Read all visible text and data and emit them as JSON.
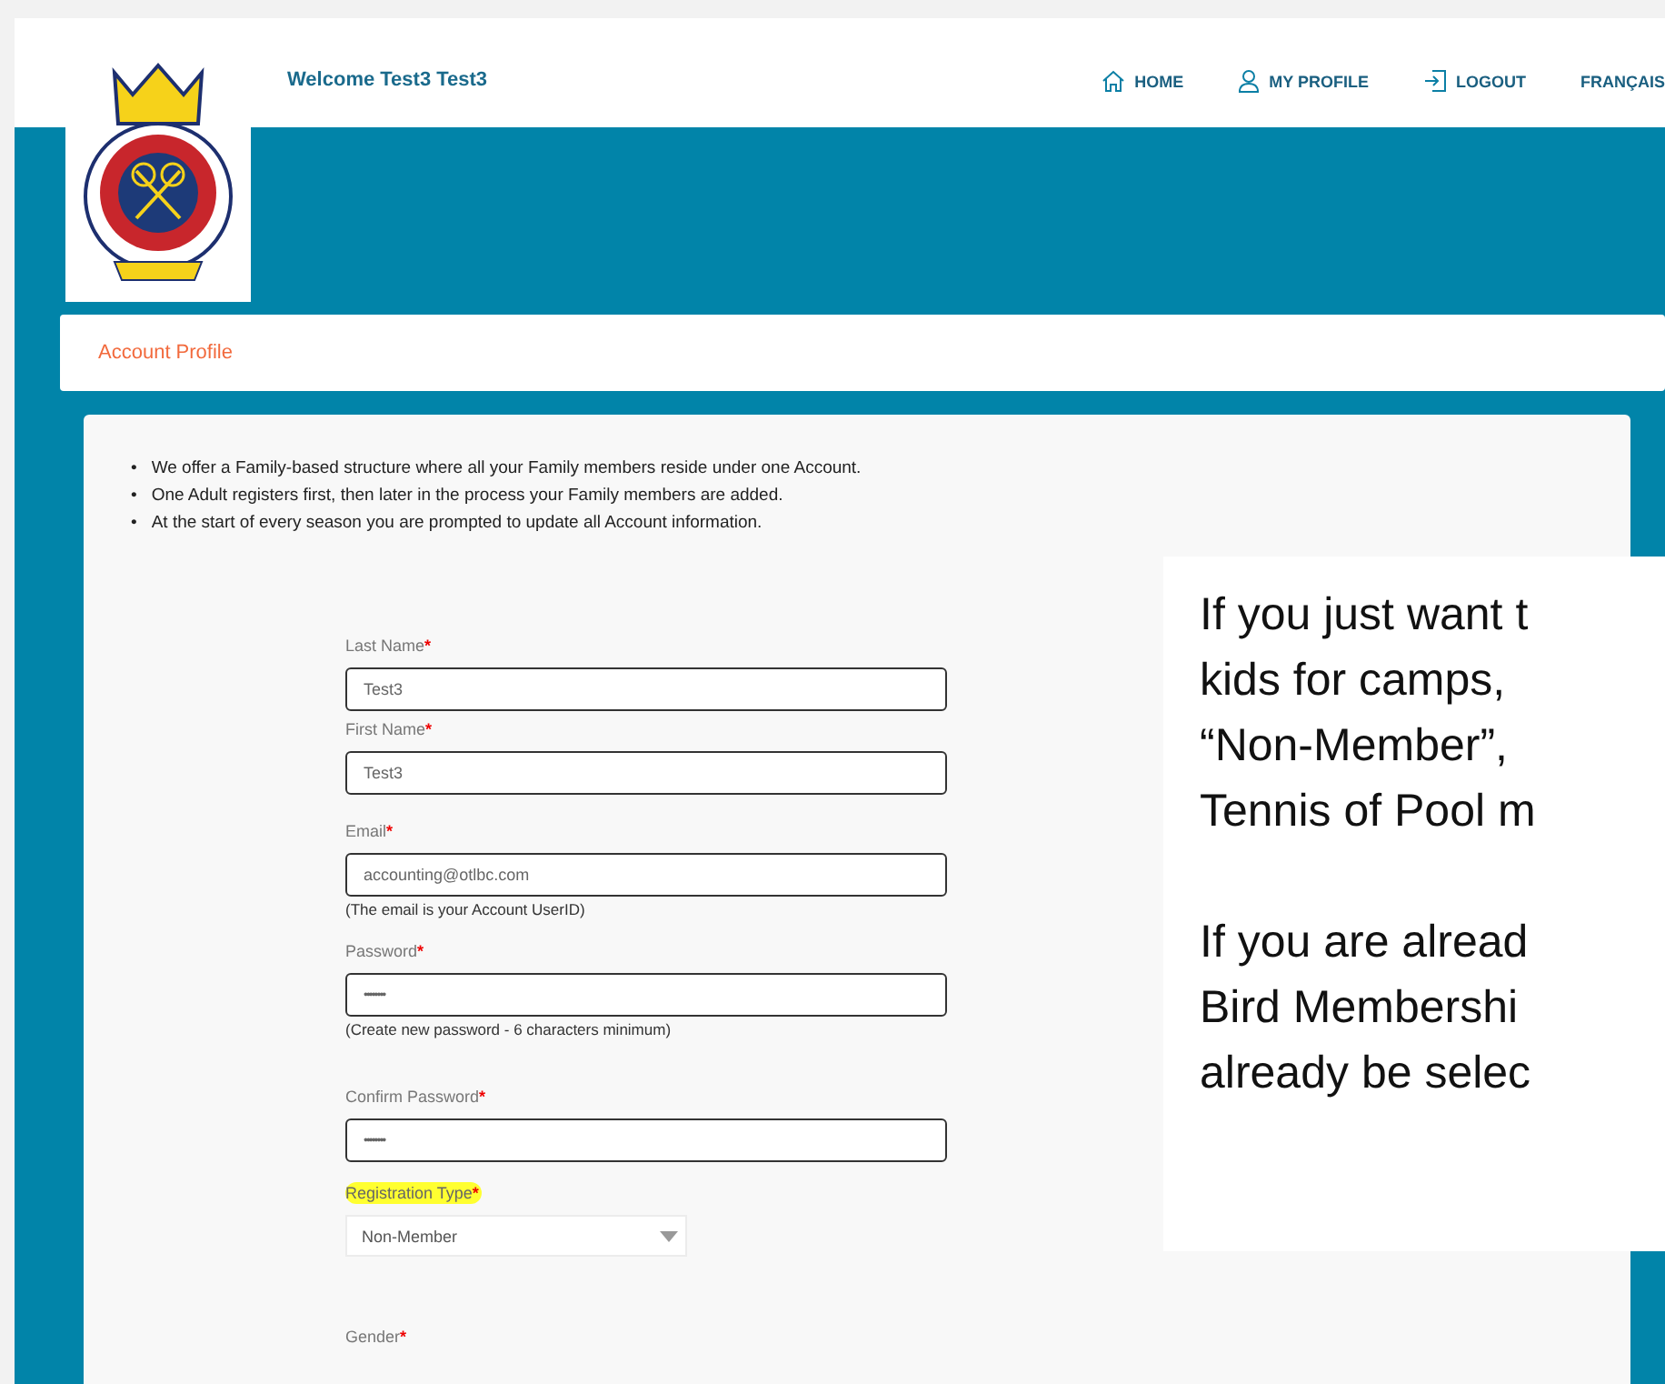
{
  "header": {
    "welcome": "Welcome Test3 Test3",
    "nav": [
      {
        "kind": "home",
        "label": "HOME"
      },
      {
        "kind": "profile",
        "label": "MY PROFILE"
      },
      {
        "kind": "logout",
        "label": "LOGOUT"
      },
      {
        "kind": "none",
        "label": "FRANÇAIS"
      }
    ]
  },
  "breadcrumb": "Account Profile",
  "bullet": "•",
  "intro": [
    "We offer a Family-based structure where all your Family members reside under one Account.",
    "One Adult registers first, then later in the process your Family members are added.",
    "At the start of every season you are prompted to update all Account information."
  ],
  "fields": [
    {
      "kind": "text",
      "label": "Last Name",
      "required": "*",
      "highlighted": false,
      "value": "Test3"
    },
    {
      "kind": "text",
      "label": "First Name",
      "required": "*",
      "highlighted": false,
      "value": "Test3"
    },
    {
      "kind": "text",
      "label": "Email",
      "required": "*",
      "highlighted": false,
      "value": "accounting@otlbc.com",
      "hint": "(The email is your Account UserID)"
    },
    {
      "kind": "password",
      "label": "Password",
      "required": "*",
      "highlighted": false,
      "value": "••••••••",
      "hint": "(Create new password - 6 characters minimum)"
    },
    {
      "kind": "password",
      "label": "Confirm Password",
      "required": "*",
      "highlighted": false,
      "value": "••••••••"
    },
    {
      "kind": "select",
      "label": "Registration Type",
      "required": "*",
      "highlighted": true,
      "value": "Non-Member"
    },
    {
      "kind": "none",
      "label": "Gender",
      "required": "*",
      "highlighted": false
    }
  ],
  "callout": {
    "paragraphs": [
      [
        "If you just want t",
        "kids for camps,",
        "“Non-Member”,",
        "Tennis of Pool m"
      ],
      [
        "If you are alread",
        "Bird Membershi",
        "already be selec"
      ]
    ]
  }
}
